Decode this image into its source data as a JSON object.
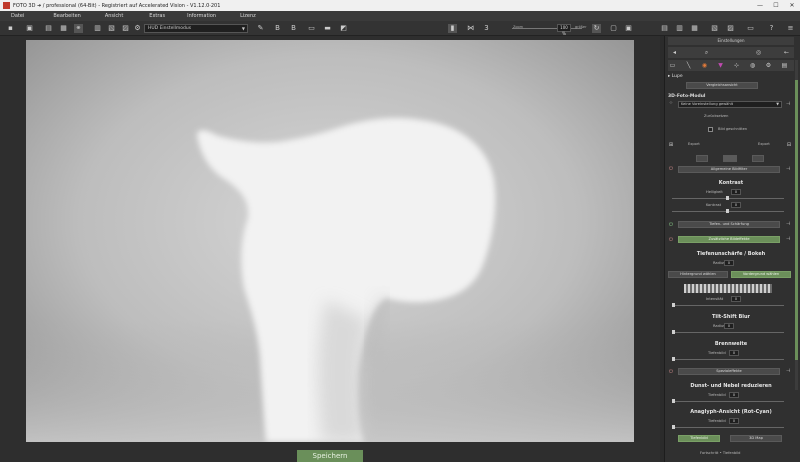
{
  "window": {
    "title": "FOTO 3D ➜ / professional (64-Bit) - Registriert auf Accelerated Vision - V1.12.0·201",
    "controls": [
      "—",
      "☐",
      "✕"
    ]
  },
  "menu": [
    "Datei",
    "Bearbeiten",
    "Ansicht",
    "Extras",
    "Information",
    "Lizenz"
  ],
  "toolbar": {
    "profile_select": "HUD Einstellmodus",
    "zoom_label": "Zoom",
    "zoom_value": "100 %",
    "zoom_right_label": "größer"
  },
  "save_button": "Speichern",
  "panel": {
    "tab_label": "Einstellungen",
    "lupe_header": "▸ Lupe",
    "vergleich_button": "Vergleichsansicht",
    "modul_header": "3D-Foto-Modul",
    "model_select": "Keine Voreinstellung gewählt",
    "reset_button": "Zurücksetzen",
    "tiefe_check_label": "Bild geschnitten",
    "export_left": "Export",
    "export_right": "Export",
    "allgemein_button": "Allgemeine Bildfilter",
    "kontrast_heading": "Kontrast",
    "helligkeit_label": "Helligkeit",
    "helligkeit_value": "0",
    "kontrast_label": "Kontrast",
    "kontrast_value": "0",
    "tiefen_button": "Tiefen- und Schärfung",
    "bokeh_button": "Zusätzliche Bildeffekte",
    "bokeh_heading": "Tiefenunschärfe / Bokeh",
    "bokeh_radius_label": "Radius",
    "bokeh_radius_value": "0",
    "hintergrund_button": "Hintergrund wählen",
    "vordergrund_button": "Vordergrund wählen",
    "intensitaet_label": "Intensität",
    "intensitaet_value": "0",
    "tiltshift_heading": "Tilt-Shift Blur",
    "tilt_radius_label": "Radius",
    "tilt_radius_value": "0",
    "weite_heading": "Brennweite",
    "weite_label": "Tiefenbild",
    "weite_value": "0",
    "spezial_button": "Spezialeffekte",
    "dunst_heading": "Dunst- und Nebel reduzieren",
    "dunst_label": "Tiefenbild",
    "dunst_value": "0",
    "anaglyph_heading": "Anaglyph-Ansicht (Rot-Cyan)",
    "anaglyph_label": "Tiefenbild",
    "anaglyph_value": "0",
    "bottom_left_button": "Tiefenbild",
    "bottom_right_button": "3D Map",
    "footer": "Fortschritt • Tiefenbild"
  }
}
